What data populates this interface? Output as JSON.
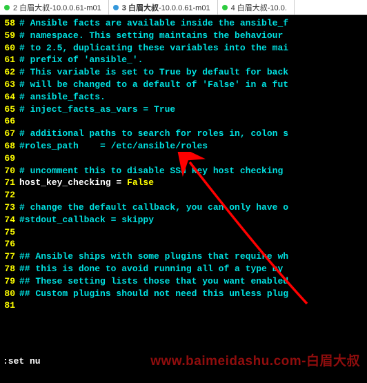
{
  "tabs": [
    {
      "num": "2",
      "label": "白眉大叔",
      "suffix": "-10.0.0.61-m01",
      "dot": "green",
      "active": false
    },
    {
      "num": "3",
      "label": "白眉大叔",
      "suffix": "-10.0.0.61-m01",
      "dot": "blue",
      "active": true
    },
    {
      "num": "4",
      "label": "白眉大叔",
      "suffix": "-10.0.",
      "dot": "green",
      "active": false
    }
  ],
  "lines": [
    {
      "ln": "58",
      "t": "comment",
      "text": "# Ansible facts are available inside the ansible_f"
    },
    {
      "ln": "59",
      "t": "comment",
      "text": "# namespace. This setting maintains the behaviour "
    },
    {
      "ln": "60",
      "t": "comment",
      "text": "# to 2.5, duplicating these variables into the mai"
    },
    {
      "ln": "61",
      "t": "comment",
      "text": "# prefix of 'ansible_'."
    },
    {
      "ln": "62",
      "t": "comment",
      "text": "# This variable is set to True by default for back"
    },
    {
      "ln": "63",
      "t": "comment",
      "text": "# will be changed to a default of 'False' in a fut"
    },
    {
      "ln": "64",
      "t": "comment",
      "text": "# ansible_facts."
    },
    {
      "ln": "65",
      "t": "comment",
      "text": "# inject_facts_as_vars = True"
    },
    {
      "ln": "66",
      "t": "blank",
      "text": ""
    },
    {
      "ln": "67",
      "t": "comment",
      "text": "# additional paths to search for roles in, colon s"
    },
    {
      "ln": "68",
      "t": "comment",
      "text": "#roles_path    = /etc/ansible/roles"
    },
    {
      "ln": "69",
      "t": "blank",
      "text": ""
    },
    {
      "ln": "70",
      "t": "comment",
      "text": "# uncomment this to disable SSH key host checking"
    },
    {
      "ln": "71",
      "t": "assign",
      "var": "host_key_checking",
      "eq": " = ",
      "val": "False"
    },
    {
      "ln": "72",
      "t": "blank",
      "text": ""
    },
    {
      "ln": "73",
      "t": "comment",
      "text": "# change the default callback, you can only have o"
    },
    {
      "ln": "74",
      "t": "comment",
      "text": "#stdout_callback = skippy"
    },
    {
      "ln": "75",
      "t": "blank",
      "text": ""
    },
    {
      "ln": "76",
      "t": "blank",
      "text": ""
    },
    {
      "ln": "77",
      "t": "comment",
      "text": "## Ansible ships with some plugins that require wh"
    },
    {
      "ln": "78",
      "t": "comment",
      "text": "## this is done to avoid running all of a type by "
    },
    {
      "ln": "79",
      "t": "comment",
      "text": "## These setting lists those that you want enabled"
    },
    {
      "ln": "80",
      "t": "comment",
      "text": "## Custom plugins should not need this unless plug"
    },
    {
      "ln": "81",
      "t": "blank",
      "text": ""
    }
  ],
  "status": ":set nu",
  "watermark": "www.baimeidashu.com-白眉大叔",
  "arrow_color": "#ff0000"
}
